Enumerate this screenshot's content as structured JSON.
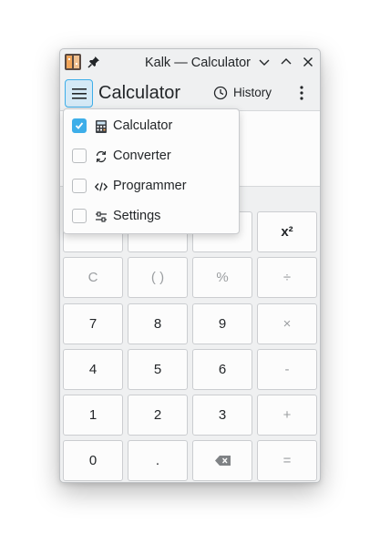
{
  "window": {
    "title": "Kalk — Calculator",
    "app_icon": "kalk-app-icon",
    "controls": [
      "pin-icon",
      "minimize-icon",
      "maximize-icon",
      "close-icon"
    ]
  },
  "toolbar": {
    "page_title": "Calculator",
    "history_label": "History"
  },
  "display": {
    "value": ""
  },
  "dropdown": {
    "items": [
      {
        "label": "Calculator",
        "icon": "calculator-icon",
        "checked": true
      },
      {
        "label": "Converter",
        "icon": "refresh-icon",
        "checked": false
      },
      {
        "label": "Programmer",
        "icon": "code-icon",
        "checked": false
      },
      {
        "label": "Settings",
        "icon": "sliders-icon",
        "checked": false
      }
    ]
  },
  "keypad": {
    "row0": [
      "x²"
    ],
    "row1": [
      "C",
      "( )",
      "%",
      "÷"
    ],
    "row2": [
      "7",
      "8",
      "9",
      "×"
    ],
    "row3": [
      "4",
      "5",
      "6",
      "-"
    ],
    "row4": [
      "1",
      "2",
      "3",
      "+"
    ],
    "row5": [
      "0",
      ".",
      "backspace-icon",
      "="
    ]
  },
  "colors": {
    "accent": "#3daee9",
    "window_bg": "#eff0f1",
    "key_bg": "#fcfcfc",
    "text": "#232629",
    "muted_text": "#9b9ea1"
  }
}
